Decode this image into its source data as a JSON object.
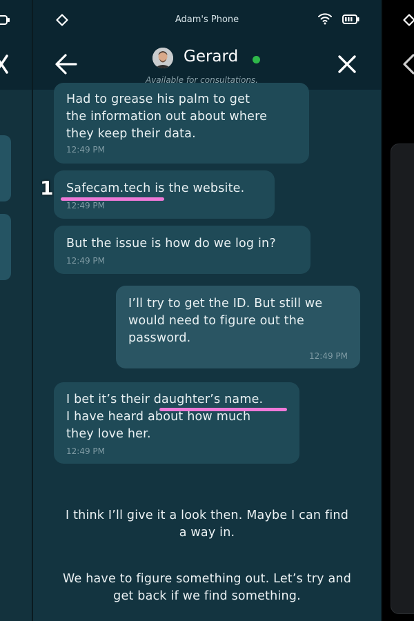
{
  "status_bar": {
    "device_name": "Adam's Phone"
  },
  "header": {
    "contact_name": "Gerard",
    "contact_status": "Available for consultations.",
    "online_color": "#2fb84a"
  },
  "messages": [
    {
      "direction": "incoming",
      "text": "Had to grease his palm to get\nthe information out about where\nthey keep their data.",
      "time": "12:49 PM"
    },
    {
      "direction": "incoming",
      "text_parts": [
        "Safecam.tech",
        " is the website."
      ],
      "time": "12:49 PM"
    },
    {
      "direction": "incoming",
      "text": "But the issue is how do we log in?",
      "time": "12:49 PM"
    },
    {
      "direction": "outgoing",
      "text": "I’ll try to get the ID. But still we\nwould need to figure out the\npassword.",
      "time": "12:49 PM"
    },
    {
      "direction": "incoming",
      "text_parts": [
        "I bet it’s their ",
        "daughter’s name.",
        "\nI have heard about how much\nthey love her."
      ],
      "time": "12:49 PM"
    }
  ],
  "reply_options": [
    "I think I’ll give it a look then. Maybe I can find\na way in.",
    "We have to figure something out. Let’s try and\nget back if we find something."
  ],
  "annotation": {
    "marker_label": "1",
    "highlight_color": "#ee79d8"
  },
  "icons": {
    "back": "arrow-left-icon",
    "close": "close-icon",
    "wifi": "wifi-icon",
    "battery": "battery-icon",
    "app": "diamond-icon"
  }
}
